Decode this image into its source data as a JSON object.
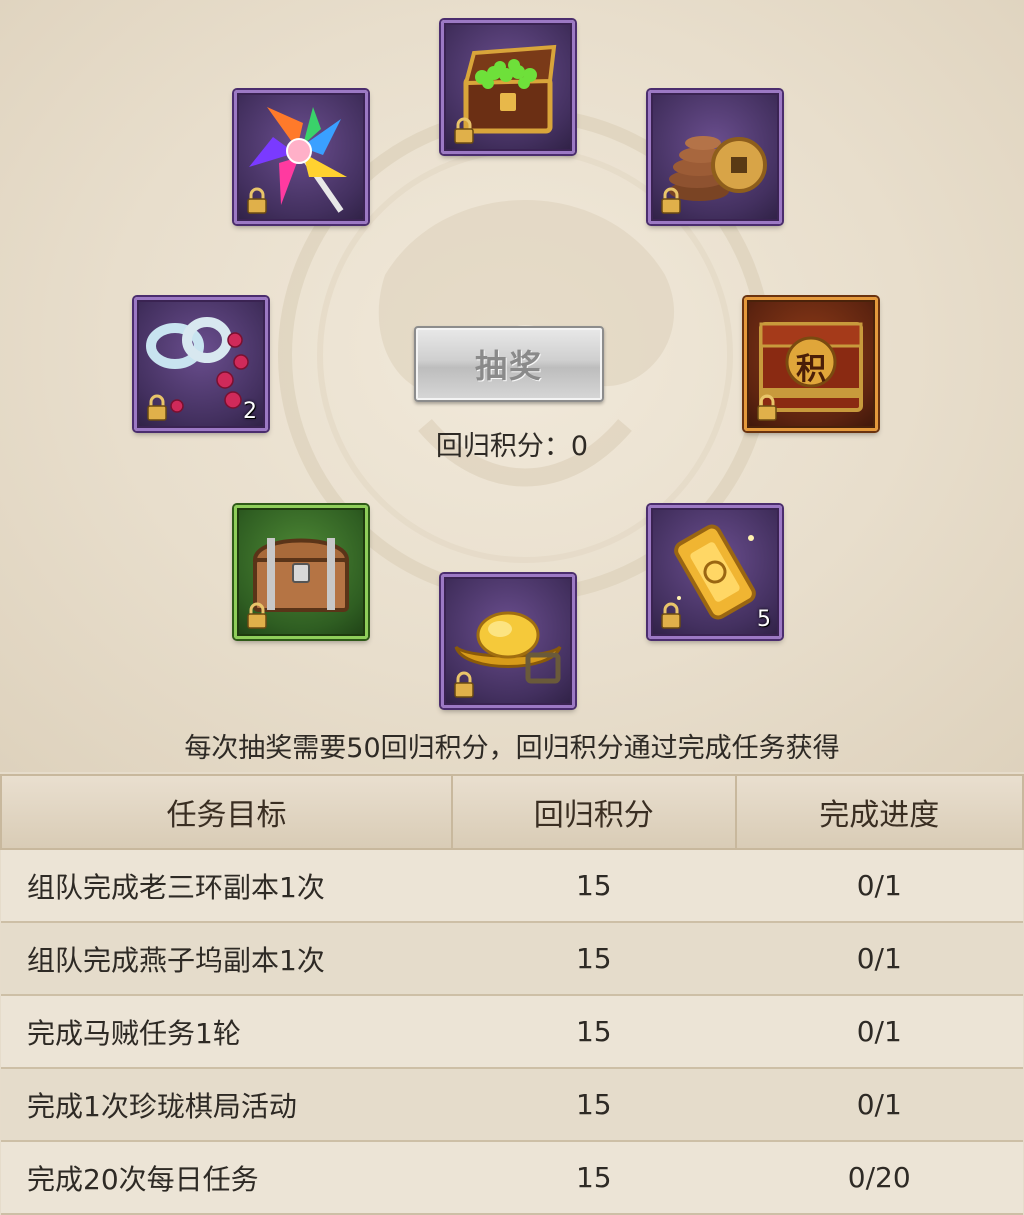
{
  "draw_button": {
    "label": "抽奖"
  },
  "score": {
    "label": "回归积分：",
    "value": "0"
  },
  "rule_text": "每次抽奖需要50回归积分，回归积分通过完成任务获得",
  "items": [
    {
      "id": "treasure-chest-green",
      "icon": "treasure-chest-icon",
      "rarity": "purple",
      "locked": true,
      "count": ""
    },
    {
      "id": "coins",
      "icon": "copper-coins-icon",
      "rarity": "purple",
      "locked": true,
      "count": ""
    },
    {
      "id": "jifen-box",
      "icon": "points-box-icon",
      "rarity": "orange",
      "locked": true,
      "count": "",
      "label": "积"
    },
    {
      "id": "gold-token",
      "icon": "gold-token-icon",
      "rarity": "purple",
      "locked": true,
      "count": "5"
    },
    {
      "id": "gold-ingot",
      "icon": "gold-ingot-icon",
      "rarity": "purple",
      "locked": true,
      "count": ""
    },
    {
      "id": "wooden-chest",
      "icon": "wooden-chest-icon",
      "rarity": "green",
      "locked": true,
      "count": ""
    },
    {
      "id": "ring-beads",
      "icon": "ring-beads-icon",
      "rarity": "purple",
      "locked": true,
      "count": "2"
    },
    {
      "id": "pinwheel",
      "icon": "pinwheel-icon",
      "rarity": "purple",
      "locked": true,
      "count": ""
    }
  ],
  "task_table": {
    "headers": [
      "任务目标",
      "回归积分",
      "完成进度"
    ],
    "rows": [
      {
        "task": "组队完成老三环副本1次",
        "points": "15",
        "progress": "0/1"
      },
      {
        "task": "组队完成燕子坞副本1次",
        "points": "15",
        "progress": "0/1"
      },
      {
        "task": "完成马贼任务1轮",
        "points": "15",
        "progress": "0/1"
      },
      {
        "task": "完成1次珍珑棋局活动",
        "points": "15",
        "progress": "0/1"
      },
      {
        "task": "完成20次每日任务",
        "points": "15",
        "progress": "0/20"
      }
    ]
  },
  "colors": {
    "background": "#e6dccb",
    "purple_frame": "#9c79c4",
    "green_frame": "#8fce5a",
    "orange_frame": "#e59a3c"
  }
}
